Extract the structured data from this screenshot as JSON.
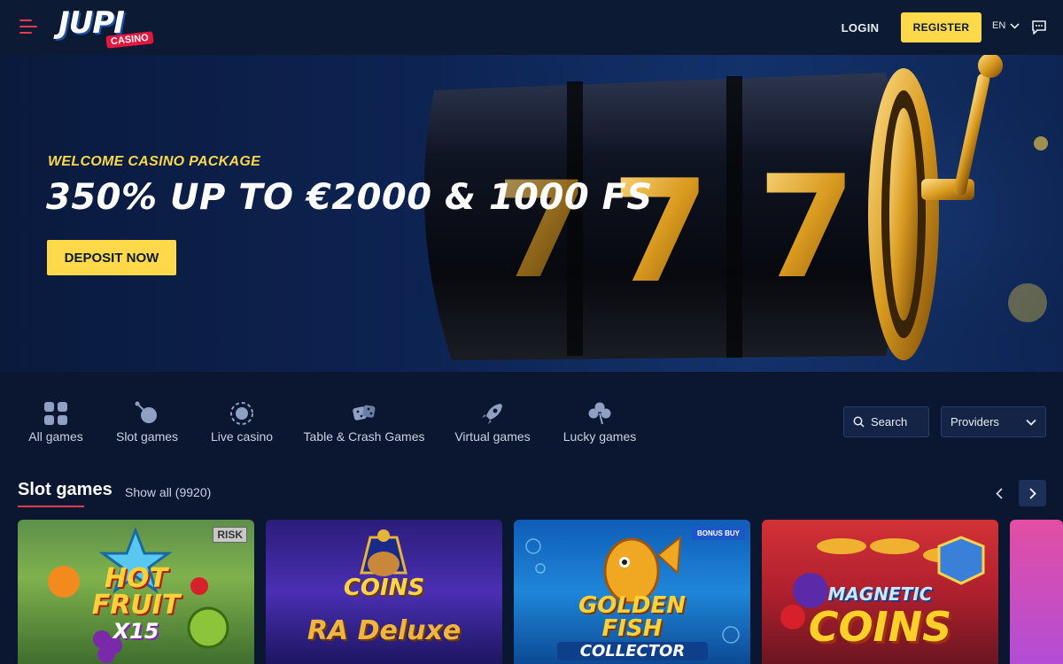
{
  "header": {
    "logo_main": "JUPI",
    "logo_sub": "CASINO",
    "login_label": "LOGIN",
    "register_label": "REGISTER",
    "language": "EN"
  },
  "hero": {
    "kicker": "WELCOME CASINO PACKAGE",
    "title": "350% UP TO €2000 & 1000 FS",
    "cta_label": "DEPOSIT NOW",
    "reel_symbols": [
      "7",
      "7",
      "7"
    ]
  },
  "categories": [
    {
      "label": "All games",
      "icon": "grid-icon"
    },
    {
      "label": "Slot games",
      "icon": "slot-icon"
    },
    {
      "label": "Live casino",
      "icon": "live-icon"
    },
    {
      "label": "Table & Crash Games",
      "icon": "dice-icon"
    },
    {
      "label": "Virtual games",
      "icon": "rocket-icon"
    },
    {
      "label": "Lucky games",
      "icon": "clover-icon"
    }
  ],
  "filters": {
    "search_label": "Search",
    "providers_label": "Providers"
  },
  "slots": {
    "title": "Slot games",
    "show_all": "Show all (9920)",
    "games": [
      {
        "title": "HOT FRUIT",
        "subtitle": "X15",
        "badge": "RISK"
      },
      {
        "title": "COINS",
        "subtitle": "RA Deluxe",
        "badge": ""
      },
      {
        "title": "GOLDEN FISH",
        "subtitle": "COLLECTOR",
        "badge": "BONUS BUY"
      },
      {
        "title": "MAGNETIC",
        "subtitle": "COINS",
        "badge": ""
      },
      {
        "title": "",
        "subtitle": "",
        "badge": ""
      }
    ]
  },
  "colors": {
    "background": "#0b1730",
    "accent_yellow": "#ffd94a",
    "accent_red": "#e23b4e"
  }
}
